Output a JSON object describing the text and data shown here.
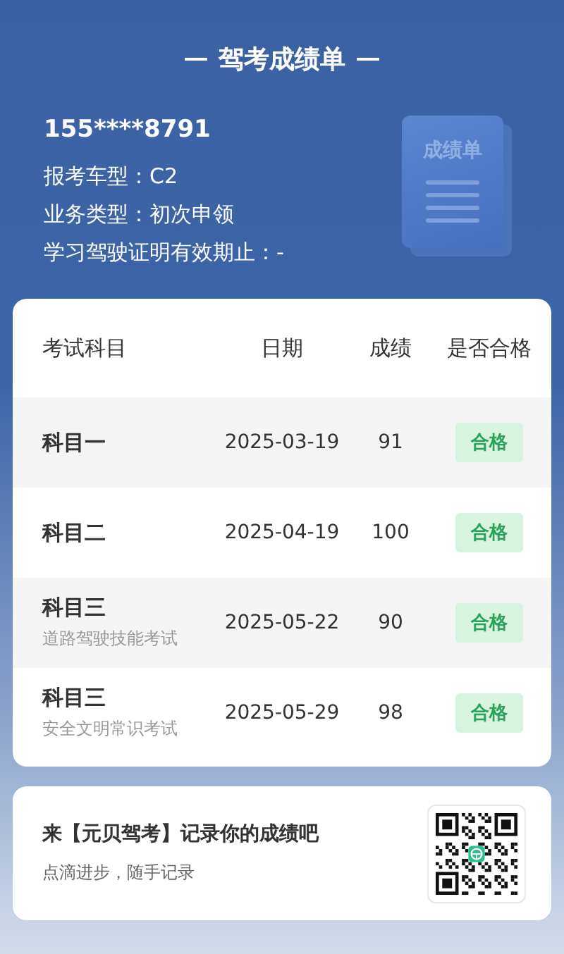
{
  "title": "驾考成绩单",
  "profile": {
    "phone": "155****8791",
    "fields": [
      {
        "label": "报考车型：",
        "value": "C2"
      },
      {
        "label": "业务类型：",
        "value": "初次申领"
      },
      {
        "label": "学习驾驶证明有效期止：",
        "value": "-"
      }
    ],
    "illustration_text": "成绩单"
  },
  "table": {
    "columns": [
      "考试科目",
      "日期",
      "成绩",
      "是否合格"
    ],
    "rows": [
      {
        "subject": "科目一",
        "date": "2025-03-19",
        "score": "91",
        "result": "合格",
        "passed": true
      },
      {
        "subject": "科目二",
        "date": "2025-04-19",
        "score": "100",
        "result": "合格",
        "passed": true
      },
      {
        "subject": "科目三",
        "subtitle": "道路驾驶技能考试",
        "date": "2025-05-22",
        "score": "90",
        "result": "合格",
        "passed": true
      },
      {
        "subject": "科目三",
        "subtitle": "安全文明常识考试",
        "date": "2025-05-29",
        "score": "98",
        "result": "合格",
        "passed": true
      }
    ]
  },
  "promo": {
    "headline": "来【元贝驾考】记录你的成绩吧",
    "subline": "点滴进步，随手记录"
  }
}
